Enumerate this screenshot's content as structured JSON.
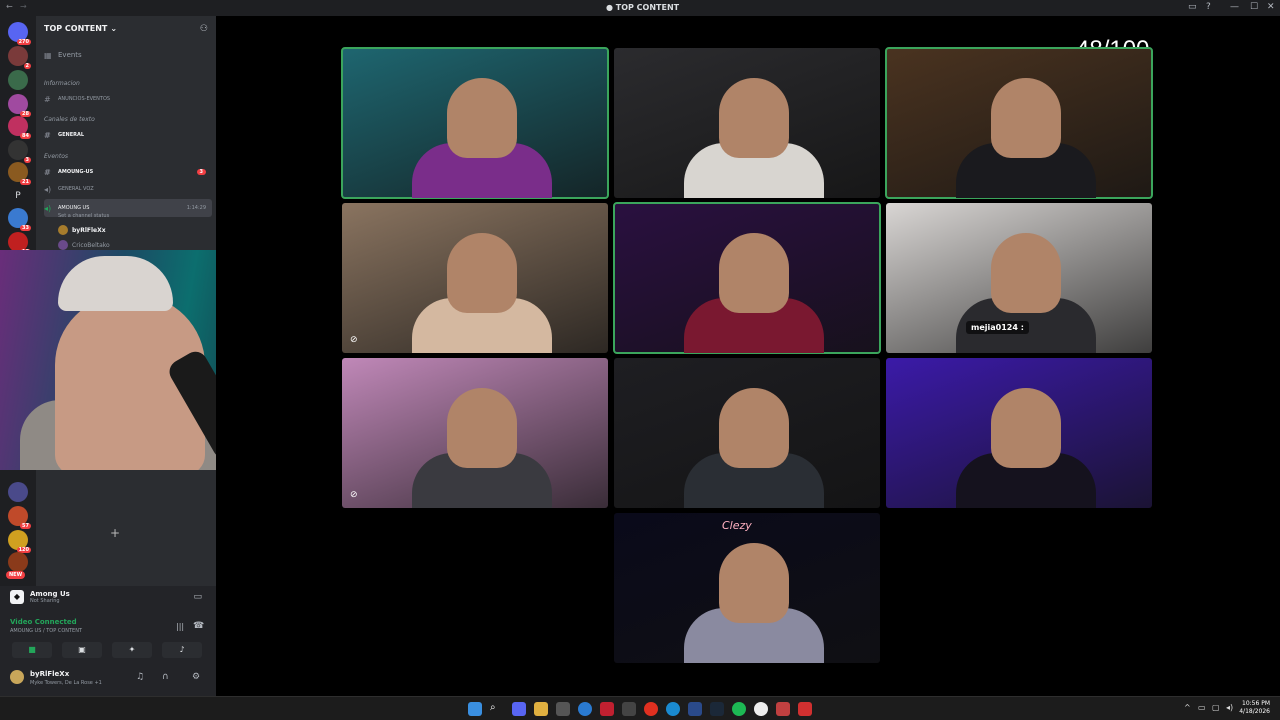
{
  "window": {
    "title": "TOP CONTENT",
    "title_icon": "server-icon",
    "back_icon": "←",
    "forward_icon": "→",
    "controls": [
      "▭",
      "?",
      "—",
      "☐",
      "✕"
    ]
  },
  "rail": {
    "badges": [
      "270",
      "2",
      "28",
      "84",
      "3",
      "21",
      "33",
      "16",
      "57",
      "120"
    ],
    "new_label": "NEW",
    "letter_server": "P"
  },
  "sidebar": {
    "server_name": "TOP CONTENT",
    "events_label": "Events",
    "categories": {
      "informacion": "Informacion",
      "canales_texto": "Canales de texto",
      "eventos": "Eventos"
    },
    "channels": [
      {
        "label": "ANUNCIOS-EVENTOS"
      },
      {
        "label": "GENERAL"
      },
      {
        "label": "AMOUNG-US",
        "mentions": "3"
      },
      {
        "label": "GENERAL VOZ"
      },
      {
        "label": "AMOUNG US",
        "timer": "1:14:29",
        "status": "Set a channel status"
      }
    ],
    "members": [
      "byRlFleXx",
      "CricoBeltako"
    ]
  },
  "voice_panel": {
    "activity_name": "Among Us",
    "activity_status": "Not Sharing",
    "connection_title": "Video Connected",
    "connection_sub": "AMOUNG US / TOP CONTENT",
    "user_name": "byRlFleXx",
    "user_status": "Myke Towers, De La Rose +1"
  },
  "stage": {
    "score": "48/100",
    "tiles": [
      {
        "id": 1,
        "speaking": true,
        "bg": "#1e6670",
        "accent": "#7a2d8a"
      },
      {
        "id": 2,
        "speaking": false,
        "bg": "#2b2b2e",
        "accent": "#d8d5d0"
      },
      {
        "id": 3,
        "speaking": true,
        "bg": "#4a3320",
        "accent": "#1a1a1e"
      },
      {
        "id": 4,
        "speaking": false,
        "bg": "#8a7460",
        "accent": "#d4b8a0"
      },
      {
        "id": 5,
        "speaking": true,
        "bg": "#2a1040",
        "accent": "#7a1830"
      },
      {
        "id": 6,
        "speaking": false,
        "bg": "#d9d6d4",
        "accent": "#2a2a2e",
        "name": "mejia0124 :"
      },
      {
        "id": 7,
        "speaking": false,
        "bg": "#c088b8",
        "accent": "#3a3a40"
      },
      {
        "id": 8,
        "speaking": false,
        "bg": "#1e1e22",
        "accent": "#2a2e34"
      },
      {
        "id": 9,
        "speaking": false,
        "bg": "#3b1aa8",
        "accent": "#15121e"
      },
      {
        "id": 10,
        "speaking": false,
        "bg": "#0a0a1a",
        "accent": "#8a8aa0",
        "label": "Clezy"
      }
    ]
  },
  "taskbar": {
    "time": "10:56 PM",
    "date": "4/18/2026"
  }
}
